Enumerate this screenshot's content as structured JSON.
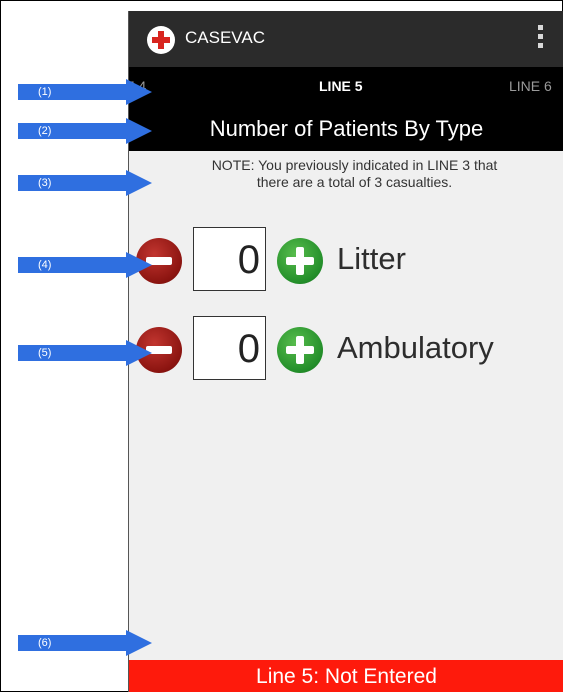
{
  "app": {
    "title": "CASEVAC",
    "icon": "red-cross-icon"
  },
  "tabs": {
    "prev": "NE 4",
    "current": "LINE 5",
    "next": "LINE 6"
  },
  "header": {
    "title": "Number of Patients By Type"
  },
  "note": {
    "line1": "NOTE: You previously indicated in LINE 3 that",
    "line2": "there are a total of 3 casualties."
  },
  "counters": [
    {
      "label": "Litter",
      "value": "0"
    },
    {
      "label": "Ambulatory",
      "value": "0"
    }
  ],
  "status": {
    "text": "Line 5: Not Entered",
    "color": "#fe1a0c"
  },
  "callouts": [
    "(1)",
    "(2)",
    "(3)",
    "(4)",
    "(5)",
    "(6)"
  ],
  "colors": {
    "callout": "#2f6fe0",
    "minus": "#8b1410",
    "plus": "#238e2a"
  }
}
